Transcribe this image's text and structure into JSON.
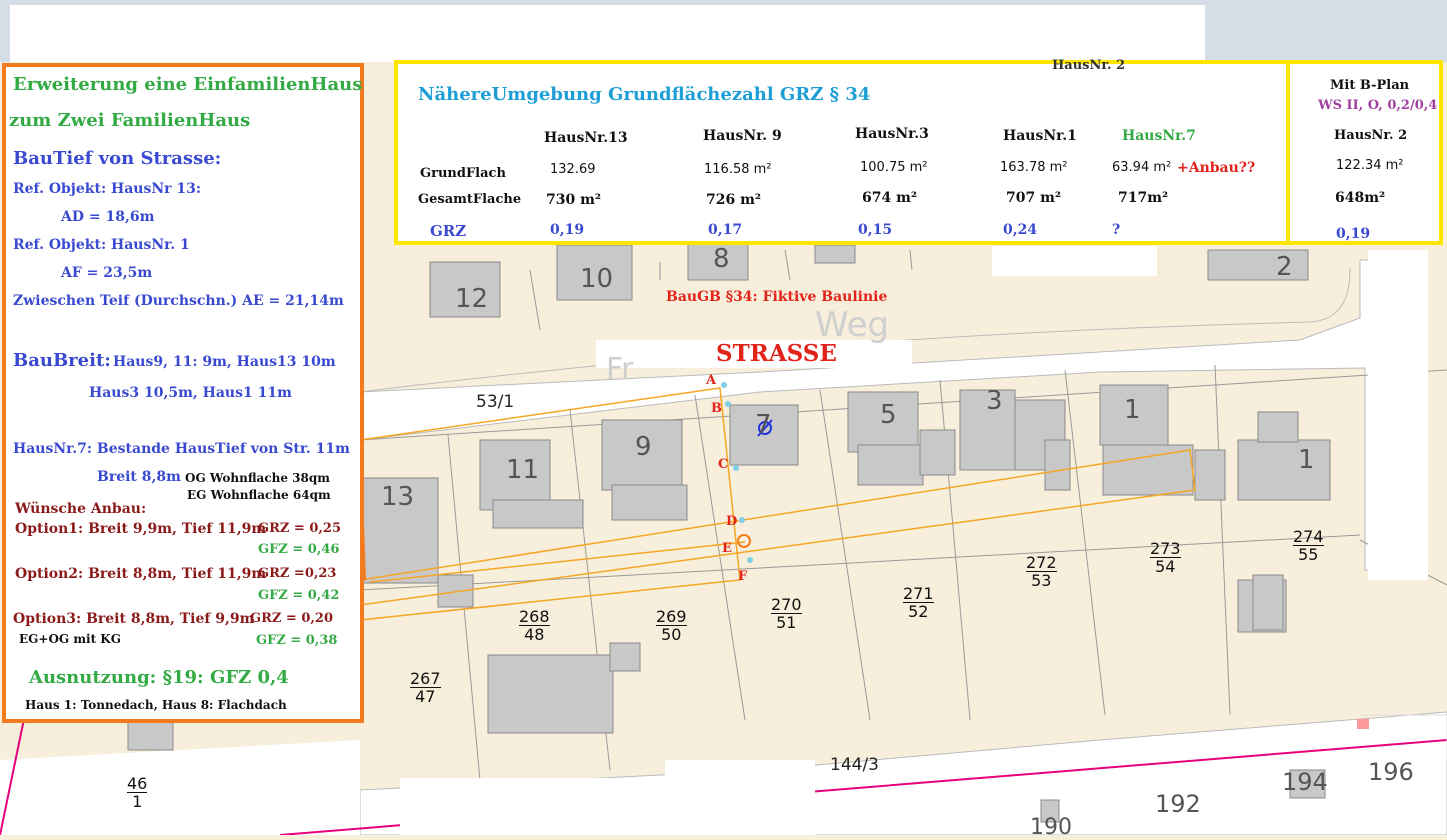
{
  "colors": {
    "green": "#33aa44",
    "blue": "#3a4ad0",
    "heading_blue": "#1d9fd6",
    "darkred": "#8b1a1a",
    "red": "#e2231a",
    "purple": "#a040a0",
    "orange": "#f27b1e",
    "yellow": "#ffe600",
    "magenta": "#e6007e",
    "building": "#c8c8c8",
    "parcel_fill": "#f7efdc",
    "road": "#ffffff"
  },
  "left_panel": {
    "title1": "Erweiterung eine EinfamilienHaus",
    "title2": "zum Zwei FamilienHaus",
    "bautief_heading": "BauTief von Strasse:",
    "ref1": "Ref. Objekt: HausNr 13:",
    "ad": "AD = 18,6m",
    "ref2": "Ref. Objekt: HausNr. 1",
    "af": "AF = 23,5m",
    "zwischen": "Zwieschen Teif (Durchschn.) AE = 21,14m",
    "baubreit_heading": "BauBreit:",
    "baubreit_line1": "Haus9, 11: 9m, Haus13 10m",
    "baubreit_line2": "Haus3 10,5m, Haus1 11m",
    "haus7_line": "HausNr.7: Bestande HausTief von Str. 11m",
    "breit": "Breit 8,8m",
    "og": "OG Wohnflache 38qm",
    "eg": "EG Wohnflache 64qm",
    "wunsche": "Wünsche Anbau:",
    "opt1": "Option1: Breit 9,9m, Tief 11,9m",
    "opt1_grz": "GRZ  = 0,25",
    "opt1_gfz": "GFZ = 0,46",
    "opt2": "Option2: Breit 8,8m, Tief 11,9m",
    "opt2_grz": "GRZ  =0,23",
    "opt2_gfz": "GFZ = 0,42",
    "opt3": "Option3: Breit 8,8m, Tief 9,9m",
    "opt3_grz": "GRZ  = 0,20",
    "opt3_gfz": "GFZ = 0,38",
    "eg_og": "EG+OG mit KG",
    "ausnutzung": "Ausnutzung: §19: GFZ 0,4",
    "dach": "Haus 1: Tonnedach, Haus 8: Flachdach"
  },
  "grz_panel": {
    "heading": "NähereUmgebung Grundflächezahl GRZ § 34",
    "row_labels": [
      "GrundFlach",
      "GesamtFlache",
      "GRZ"
    ],
    "columns": [
      {
        "name": "HausNr.13",
        "grund": "132.69",
        "gesamt": "730 m²",
        "grz": "0,19"
      },
      {
        "name": "HausNr. 9",
        "grund": "116.58 m²",
        "gesamt": "726 m²",
        "grz": "0,17"
      },
      {
        "name": "HausNr.3",
        "grund": "100.75 m²",
        "gesamt": "674 m²",
        "grz": "0,15"
      },
      {
        "name": "HausNr.1",
        "grund": "163.78 m²",
        "gesamt": "707 m²",
        "grz": "0,24"
      },
      {
        "name": "HausNr.7",
        "grund": "63.94 m²",
        "gesamt": "717m²",
        "grz": "?"
      }
    ],
    "anbau": "+Anbau??",
    "faded_label": "HausNr. 2"
  },
  "bplan_panel": {
    "title": "Mit B-Plan",
    "ws": "WS II, O, 0,2/0,4",
    "haus": "HausNr. 2",
    "grund": "122.34 m²",
    "gesamt": "648m²",
    "grz": "0,19"
  },
  "map": {
    "strasse": "STRASSE",
    "baugb": "BauGB §34: Fiktive Baulinie",
    "street_fragment": "Weg",
    "street_left_fragment": "Fr",
    "house_numbers": [
      "12",
      "10",
      "8",
      "2",
      "5",
      "3",
      "1",
      "1",
      "9",
      "11",
      "13",
      "7"
    ],
    "parcels": [
      {
        "num": "268",
        "den": "48"
      },
      {
        "num": "269",
        "den": "50"
      },
      {
        "num": "270",
        "den": "51"
      },
      {
        "num": "271",
        "den": "52"
      },
      {
        "num": "272",
        "den": "53"
      },
      {
        "num": "273",
        "den": "54"
      },
      {
        "num": "274",
        "den": "55"
      },
      {
        "num": "267",
        "den": "47"
      },
      {
        "num": "46",
        "den": "1"
      }
    ],
    "plain_labels": [
      "53/1",
      "144/3",
      "194",
      "196",
      "192",
      "190"
    ],
    "point_labels": [
      "A",
      "B",
      "C",
      "D",
      "E",
      "F"
    ]
  }
}
